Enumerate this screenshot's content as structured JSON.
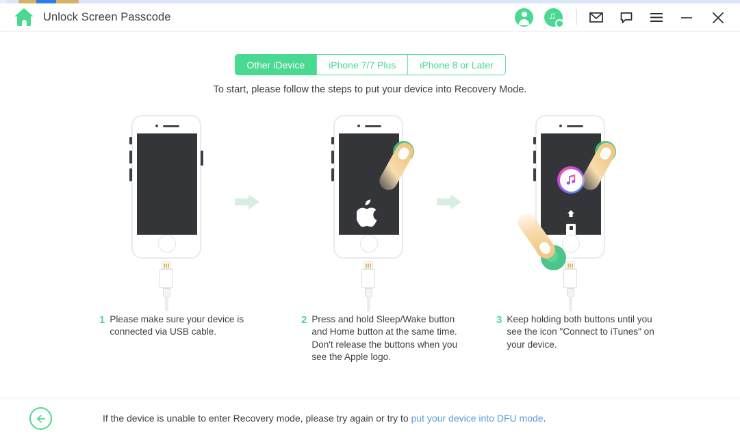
{
  "window": {
    "title": "Unlock Screen Passcode",
    "home_icon": "home-icon",
    "account_icon": "user-avatar-icon",
    "music_search_icon": "itunes-search-icon",
    "mail_icon": "mail-icon",
    "feedback_icon": "feedback-bubble-icon",
    "menu_icon": "hamburger-menu-icon",
    "minimize_icon": "minimize-icon",
    "close_icon": "close-icon"
  },
  "tabs": [
    {
      "label": "Other iDevice",
      "active": true
    },
    {
      "label": "iPhone 7/7 Plus",
      "active": false
    },
    {
      "label": "iPhone 8 or Later",
      "active": false
    }
  ],
  "subtitle": "To start, please follow the steps to put your device into Recovery Mode.",
  "steps": [
    {
      "num": "1",
      "text": "Please make sure your device is connected via USB cable."
    },
    {
      "num": "2",
      "text": "Press and hold Sleep/Wake button and Home button at the same time. Don't release the buttons when you see the Apple logo."
    },
    {
      "num": "3",
      "text": "Keep holding both buttons until you see the icon \"Connect to iTunes\" on your device."
    }
  ],
  "footer": {
    "back_icon": "back-arrow-icon",
    "text_before": "If the device is unable to enter Recovery mode, please try again or try to ",
    "link": "put your device into DFU mode",
    "text_after": "."
  },
  "colors": {
    "accent_green": "#4ad991",
    "link_blue": "#5b9bd5",
    "text_dark": "#3c4146",
    "screen_dark": "#333538",
    "arrow_mint": "#d6efe0"
  }
}
